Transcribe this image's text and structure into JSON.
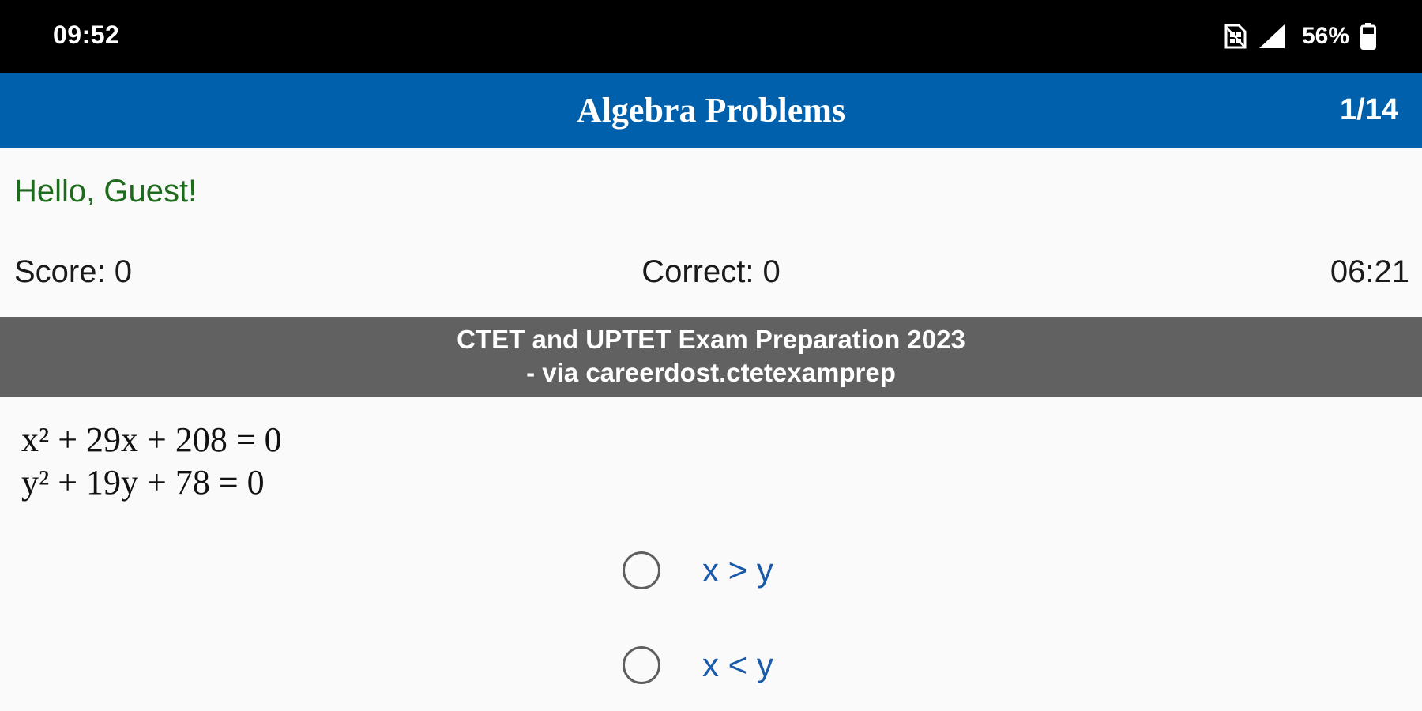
{
  "status_bar": {
    "time": "09:52",
    "battery": "56%",
    "icons": [
      "no-sim-icon",
      "signal-icon",
      "battery-icon"
    ]
  },
  "app_bar": {
    "title": "Algebra Problems",
    "counter": "1/14",
    "background_color": "#0060ab"
  },
  "greeting": "Hello, Guest!",
  "stats": {
    "score": "Score: 0",
    "correct": "Correct: 0",
    "timer": "06:21"
  },
  "banner": {
    "line1": "CTET and UPTET Exam Preparation 2023",
    "line2": "- via careerdost.ctetexamprep"
  },
  "question": {
    "line1": "x² + 29x + 208 = 0",
    "line2": "y² + 19y + 78 = 0"
  },
  "options": [
    {
      "label": "x > y",
      "selected": false
    },
    {
      "label": "x < y",
      "selected": false
    }
  ],
  "colors": {
    "greeting": "#1e6b1e",
    "option_text": "#1b5aa8",
    "banner": "#616161"
  }
}
